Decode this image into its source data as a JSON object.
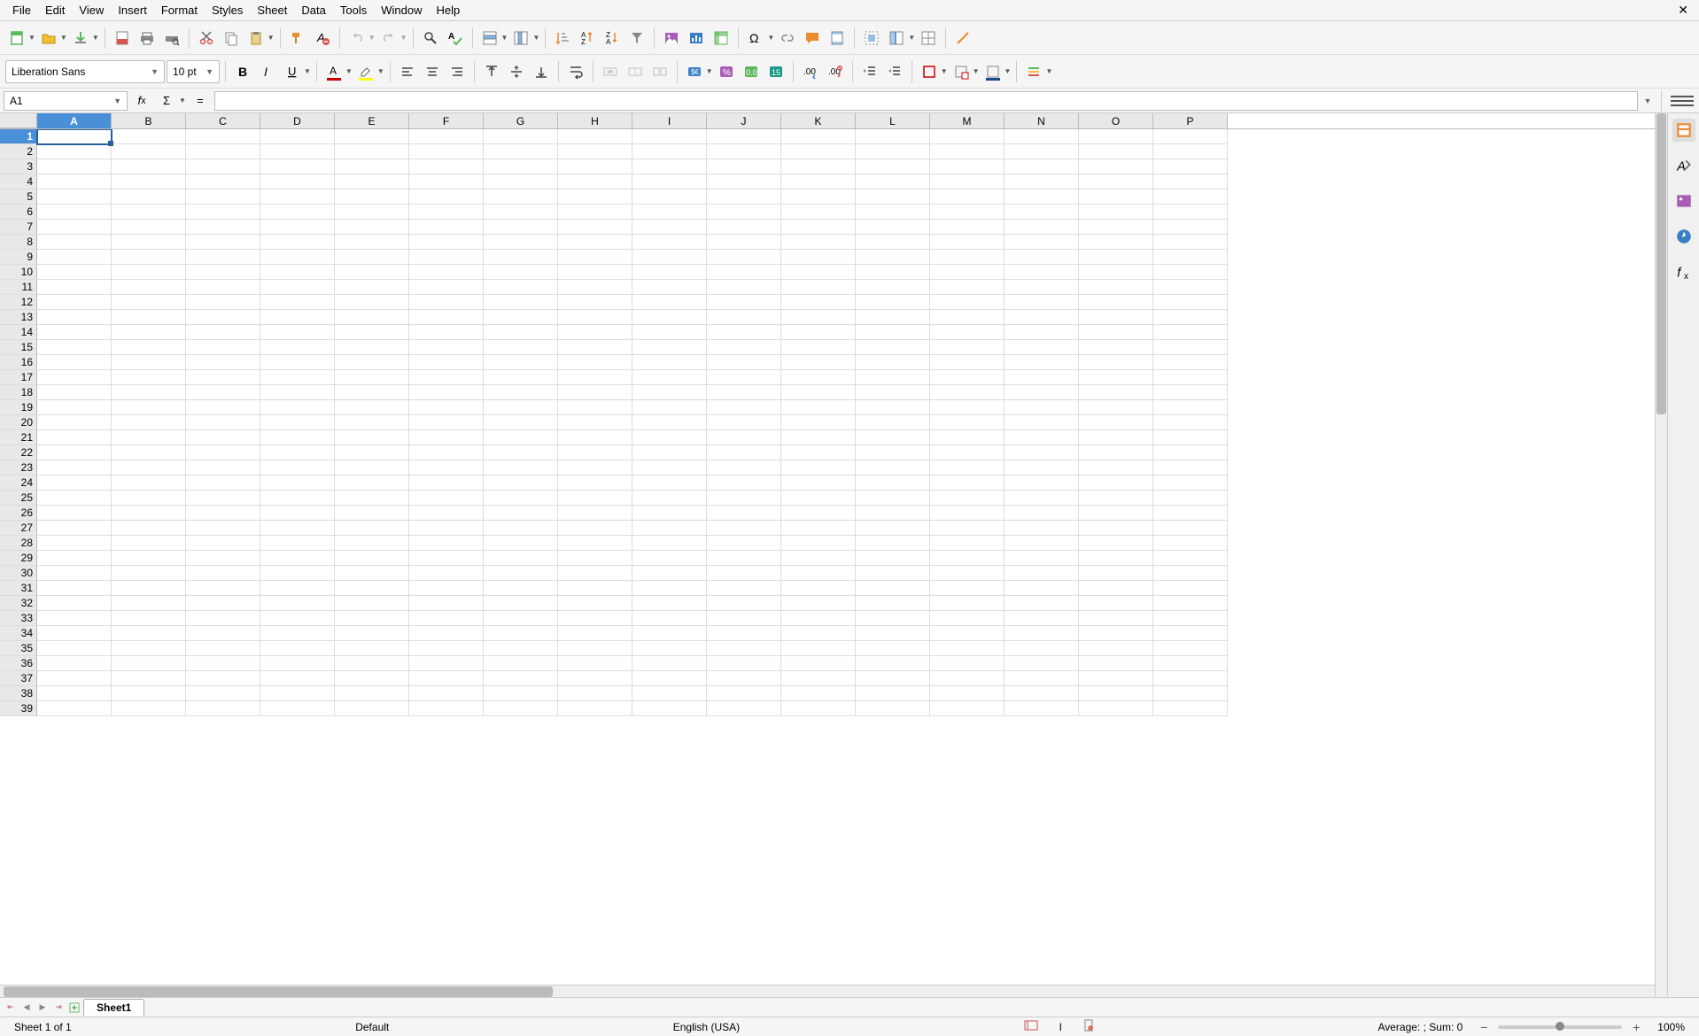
{
  "menu": {
    "items": [
      "File",
      "Edit",
      "View",
      "Insert",
      "Format",
      "Styles",
      "Sheet",
      "Data",
      "Tools",
      "Window",
      "Help"
    ]
  },
  "toolbar1": {
    "font_name": "Liberation Sans",
    "font_size": "10 pt"
  },
  "namebox": {
    "value": "A1"
  },
  "formula": {
    "value": ""
  },
  "columns": [
    "A",
    "B",
    "C",
    "D",
    "E",
    "F",
    "G",
    "H",
    "I",
    "J",
    "K",
    "L",
    "M",
    "N",
    "O",
    "P"
  ],
  "row_count": 39,
  "active_cell": {
    "row": 1,
    "col": 0
  },
  "tabs": {
    "sheet1": "Sheet1"
  },
  "status": {
    "sheet_info": "Sheet 1 of 1",
    "style": "Default",
    "lang": "English (USA)",
    "avg_sum": "Average: ; Sum: 0",
    "zoom": "100%"
  }
}
